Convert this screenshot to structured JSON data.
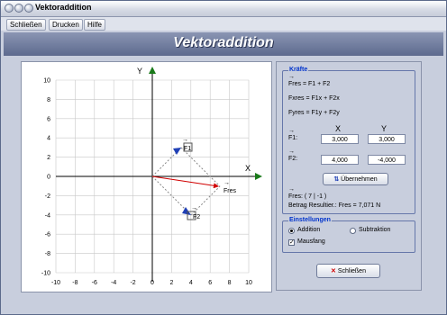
{
  "window": {
    "title": "Vektoraddition"
  },
  "menu": {
    "items": [
      "Schließen",
      "Drucken",
      "Hilfe"
    ]
  },
  "banner": {
    "title": "Vektoraddition"
  },
  "plot": {
    "x_axis_label": "X",
    "y_axis_label": "Y",
    "x_ticks": [
      "-10",
      "-8",
      "-6",
      "-4",
      "-2",
      "0",
      "2",
      "4",
      "6",
      "8",
      "10"
    ],
    "y_ticks": [
      "10",
      "8",
      "6",
      "4",
      "2",
      "0",
      "-2",
      "-4",
      "-6",
      "-8",
      "-10"
    ],
    "vector_labels": {
      "f1": "F1",
      "f2": "F2",
      "fres": "Fres"
    },
    "colors": {
      "axis_arrow": "#1a7a1a",
      "vector": "#d00000",
      "handle": "#1f3fb5",
      "grid": "#c8c8c8"
    }
  },
  "kraefte": {
    "legend": "Kräfte",
    "formula_fres": "Fres = F1 + F2",
    "formula_x": "Fxres = F1x + F2x",
    "formula_y": "Fyres = F1y + F2y",
    "col_x": "X",
    "col_y": "Y",
    "f1_label": "F1:",
    "f2_label": "F2:",
    "f1_x": "3,000",
    "f1_y": "3,000",
    "f2_x": "4,000",
    "f2_y": "-4,000",
    "apply_button": "Übernehmen",
    "fres_result": "Fres:  ( 7 | -1 )",
    "betrag": "Betrag Resultier.: Fres = 7,071 N"
  },
  "einstellungen": {
    "legend": "Einstellungen",
    "radio_addition": "Addition",
    "radio_subtraktion": "Subtraktion",
    "checkbox_mausfang": "Mausfang"
  },
  "close_button": "Schließen"
}
